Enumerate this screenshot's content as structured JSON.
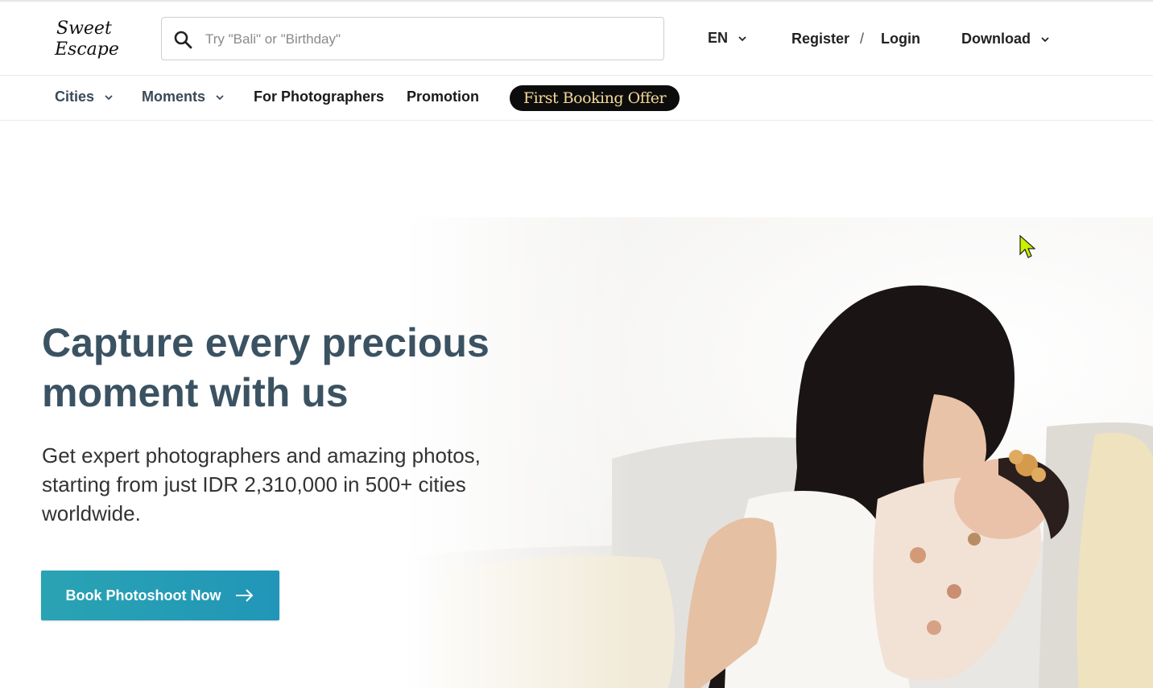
{
  "brand": {
    "logo_line1": "Sweet",
    "logo_line2": "Escape"
  },
  "search": {
    "placeholder": "Try \"Bali\" or \"Birthday\"",
    "icon": "search-icon"
  },
  "header": {
    "language": "EN",
    "register_label": "Register",
    "separator": "/",
    "login_label": "Login",
    "download_label": "Download"
  },
  "nav": {
    "cities_label": "Cities",
    "moments_label": "Moments",
    "photographers_label": "For Photographers",
    "promotion_label": "Promotion",
    "offer_part1": "First Booking",
    "offer_part2": "Offer"
  },
  "hero": {
    "title": "Capture every precious moment with us",
    "subtitle": "Get expert photographers and amazing photos, starting from just IDR 2,310,000 in 500+ cities worldwide.",
    "cta_label": "Book Photoshoot Now"
  },
  "colors": {
    "heading": "#3b5262",
    "cta_start": "#2aa3b3",
    "cta_end": "#2196b8",
    "offer_bg": "#0c0c0c",
    "offer_text": "#f0c870"
  }
}
